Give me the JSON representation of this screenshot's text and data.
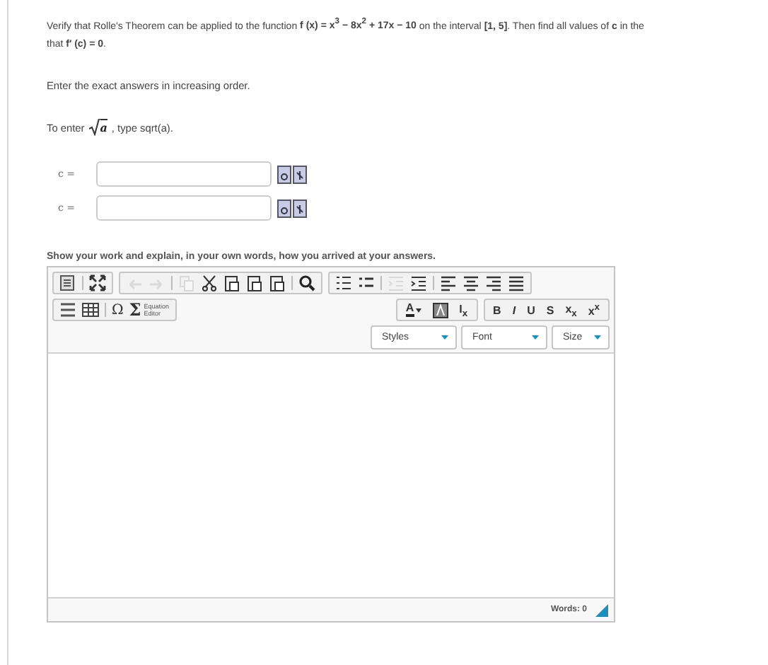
{
  "question": {
    "line_1": "Verify that Rolle's Theorem can be applied to the function **f (x) = x$^{3}$ − 8x$^{2}$ + 17x − 10** on the interval **[1, 5]**. Then find all values of **c** in the",
    "line_2": "that **f′ (c) = 0**.",
    "instruction": "Enter the exact answers in increasing order.",
    "hint_before": "To enter",
    "hint_math": "a",
    "hint_after": ", type sqrt(a)."
  },
  "answers": [
    {
      "label": "c ="
    },
    {
      "label": "c ="
    }
  ],
  "work_prompt": "Show your work and explain, in your own words, how you arrived at your answers.",
  "toolbar_row_1": [
    [
      {
        "kind": "source",
        "disabled": false
      },
      {
        "kind": "sep"
      },
      {
        "kind": "maximize",
        "disabled": false
      }
    ],
    [
      {
        "kind": "undo",
        "disabled": true
      },
      {
        "kind": "redo",
        "disabled": true
      },
      {
        "kind": "sep"
      },
      {
        "kind": "copy",
        "disabled": true
      },
      {
        "kind": "cut",
        "disabled": false
      },
      {
        "kind": "paste",
        "disabled": false
      },
      {
        "kind": "paste",
        "disabled": false
      },
      {
        "kind": "paste",
        "disabled": false
      },
      {
        "kind": "sep"
      },
      {
        "kind": "find",
        "disabled": false
      }
    ],
    [
      {
        "kind": "numlist",
        "disabled": false
      },
      {
        "kind": "bullist",
        "disabled": false
      },
      {
        "kind": "sep"
      },
      {
        "kind": "outdent",
        "disabled": true
      },
      {
        "kind": "indent",
        "disabled": false
      },
      {
        "kind": "sep"
      },
      {
        "kind": "align-left",
        "disabled": false
      },
      {
        "kind": "align-center",
        "disabled": false
      },
      {
        "kind": "align-right",
        "disabled": false
      },
      {
        "kind": "justify",
        "disabled": false
      }
    ]
  ],
  "toolbar_row_2_left": [
    {
      "kind": "hline",
      "disabled": false
    },
    {
      "kind": "table",
      "disabled": false
    },
    {
      "kind": "sep"
    },
    {
      "kind": "letter",
      "label": "Ω",
      "disabled": false
    },
    {
      "kind": "equation",
      "label": "Σ",
      "caption_1": "Equation",
      "caption_2": "Editor",
      "disabled": false
    }
  ],
  "toolbar_row_2_right": [
    [
      {
        "kind": "color",
        "label": "A",
        "disabled": false
      },
      {
        "kind": "bgcolor",
        "disabled": false
      },
      {
        "kind": "letter",
        "label": "I$_{x}$",
        "disabled": false
      }
    ],
    [
      {
        "kind": "letter",
        "label": "**B**",
        "disabled": false
      },
      {
        "kind": "letter",
        "label": "*I*",
        "disabled": false
      },
      {
        "kind": "letter",
        "label": "U",
        "disabled": false
      },
      {
        "kind": "letter",
        "label": "S",
        "disabled": false
      },
      {
        "kind": "letter",
        "label": "x$_{x}$",
        "disabled": false
      },
      {
        "kind": "letter",
        "label": "x$^{x}$",
        "disabled": false
      }
    ]
  ],
  "dropdowns": [
    "Styles",
    "Font",
    "Size"
  ],
  "word_count": "Words: 0"
}
